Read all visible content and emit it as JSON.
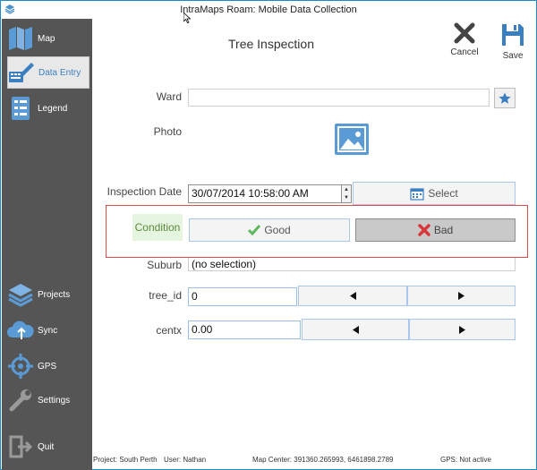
{
  "window": {
    "title": "IntraMaps Roam: Mobile Data Collection"
  },
  "sidebar": {
    "items": [
      {
        "label": "Map",
        "icon": "map-icon"
      },
      {
        "label": "Data Entry",
        "icon": "data-entry-icon",
        "active": true
      },
      {
        "label": "Legend",
        "icon": "legend-icon"
      },
      {
        "label": "Projects",
        "icon": "projects-icon"
      },
      {
        "label": "Sync",
        "icon": "sync-icon"
      },
      {
        "label": "GPS",
        "icon": "gps-icon"
      },
      {
        "label": "Settings",
        "icon": "settings-icon"
      },
      {
        "label": "Quit",
        "icon": "quit-icon"
      }
    ]
  },
  "header": {
    "form_title": "Tree Inspection",
    "cancel_label": "Cancel",
    "save_label": "Save"
  },
  "form": {
    "ward_label": "Ward",
    "ward_value": "",
    "photo_label": "Photo",
    "inspection_date_label": "Inspection Date",
    "inspection_date_value": "30/07/2014 10:58:00 AM",
    "select_label": "Select",
    "condition_label": "Condition",
    "good_label": "Good",
    "bad_label": "Bad",
    "suburb_label": "Suburb",
    "suburb_value": "(no selection)",
    "tree_id_label": "tree_id",
    "tree_id_value": "0",
    "centx_label": "centx",
    "centx_value": "0.00"
  },
  "status": {
    "project": "Project: South Perth",
    "user": "User: Nathan",
    "map_center": "Map Center: 391360.265993, 6461898.2789",
    "gps": "GPS: Not active"
  },
  "colors": {
    "sidebar_bg": "#555555",
    "accent_blue": "#3a7fc0",
    "highlight_red": "#e34a4a",
    "good_green": "#5cb85c",
    "bad_red": "#d9383a"
  }
}
